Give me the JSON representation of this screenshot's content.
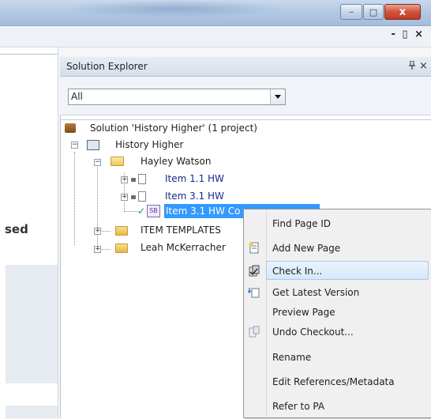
{
  "window": {
    "title_controls": {
      "minimize": "‒",
      "maximize": "□",
      "close": "x"
    },
    "strip_controls": "- ▯ ×"
  },
  "left_pane": {
    "partial_text": "sed"
  },
  "solution_explorer": {
    "title": "Solution Explorer",
    "pin_glyph": "ᵩ",
    "close_glyph": "×",
    "filter": {
      "value": "All"
    },
    "tree": {
      "solution": "Solution 'History Higher' (1 project)",
      "project": "History Higher",
      "folder_open": "Hayley Watson",
      "items": [
        "Item 1.1 HW",
        "Item 3.1 HW",
        "Item 3.1 HW Co"
      ],
      "folders": [
        "ITEM TEMPLATES",
        "Leah McKerracher"
      ],
      "selected_badge": "SB",
      "checkmark": "✓"
    }
  },
  "context_menu": {
    "items": [
      {
        "label": "Find Page ID",
        "icon": "none"
      },
      {
        "label": "Add New Page",
        "icon": "new-page-icon"
      },
      {
        "label": "Check In...",
        "icon": "check-in-icon",
        "highlighted": true
      },
      {
        "label": "Get Latest Version",
        "icon": "get-latest-icon"
      },
      {
        "label": "Preview Page",
        "icon": "none"
      },
      {
        "label": "Undo Checkout...",
        "icon": "undo-checkout-icon"
      },
      {
        "label": "Rename",
        "icon": "none"
      },
      {
        "label": "Edit References/Metadata",
        "icon": "none"
      },
      {
        "label": "Refer to PA",
        "icon": "none"
      }
    ]
  },
  "colors": {
    "selection": "#3399ff",
    "link_text": "#1a2a8a",
    "close_button": "#c23b20"
  }
}
